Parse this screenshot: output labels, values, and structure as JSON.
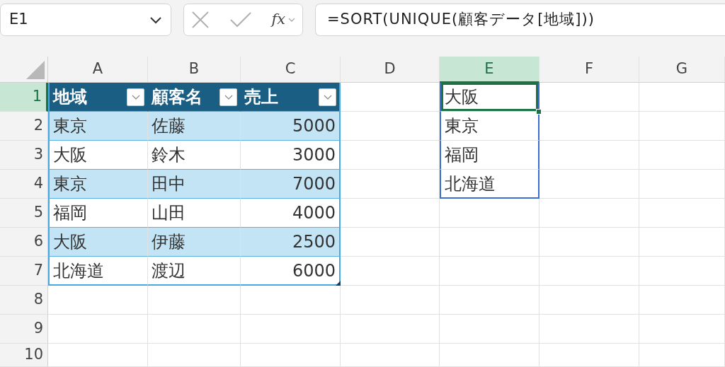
{
  "name_box": {
    "value": "E1"
  },
  "formula_bar": {
    "function_label": "fx",
    "formula": "=SORT(UNIQUE(顧客データ[地域]))"
  },
  "columns": [
    {
      "label": "A",
      "selected": false
    },
    {
      "label": "B",
      "selected": false
    },
    {
      "label": "C",
      "selected": false
    },
    {
      "label": "D",
      "selected": false
    },
    {
      "label": "E",
      "selected": true
    },
    {
      "label": "F",
      "selected": false
    },
    {
      "label": "G",
      "selected": false
    }
  ],
  "rows": [
    {
      "label": "1",
      "selected": true
    },
    {
      "label": "2",
      "selected": false
    },
    {
      "label": "3",
      "selected": false
    },
    {
      "label": "4",
      "selected": false
    },
    {
      "label": "5",
      "selected": false
    },
    {
      "label": "6",
      "selected": false
    },
    {
      "label": "7",
      "selected": false
    },
    {
      "label": "8",
      "selected": false
    },
    {
      "label": "9",
      "selected": false
    },
    {
      "label": "10",
      "selected": false
    }
  ],
  "table": {
    "headers": [
      "地域",
      "顧客名",
      "売上"
    ],
    "rows": [
      [
        "東京",
        "佐藤",
        "5000"
      ],
      [
        "大阪",
        "鈴木",
        "3000"
      ],
      [
        "東京",
        "田中",
        "7000"
      ],
      [
        "福岡",
        "山田",
        "4000"
      ],
      [
        "大阪",
        "伊藤",
        "2500"
      ],
      [
        "北海道",
        "渡辺",
        "6000"
      ]
    ]
  },
  "spill": {
    "values": [
      "大阪",
      "東京",
      "福岡",
      "北海道"
    ]
  }
}
